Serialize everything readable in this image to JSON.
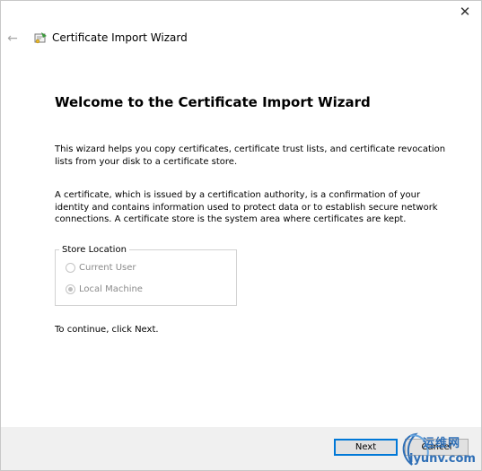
{
  "window": {
    "close_glyph": "✕",
    "back_glyph": "←",
    "title": "Certificate Import Wizard",
    "title_icon": "certificate-icon"
  },
  "content": {
    "heading": "Welcome to the Certificate Import Wizard",
    "paragraph1": "This wizard helps you copy certificates, certificate trust lists, and certificate revocation lists from your disk to a certificate store.",
    "paragraph2": "A certificate, which is issued by a certification authority, is a confirmation of your identity and contains information used to protect data or to establish secure network connections. A certificate store is the system area where certificates are kept.",
    "store_location": {
      "legend": "Store Location",
      "options": [
        {
          "label": "Current User",
          "selected": false,
          "enabled": false
        },
        {
          "label": "Local Machine",
          "selected": true,
          "enabled": false
        }
      ]
    },
    "continue_text": "To continue, click Next."
  },
  "buttons": {
    "next": "Next",
    "cancel": "Cancel"
  },
  "watermark": {
    "top": "运维网",
    "bottom": "iyunv.com"
  },
  "colors": {
    "accent": "#0078d7",
    "footer_bg": "#f0f0f0",
    "watermark": "#2f6fb6"
  }
}
